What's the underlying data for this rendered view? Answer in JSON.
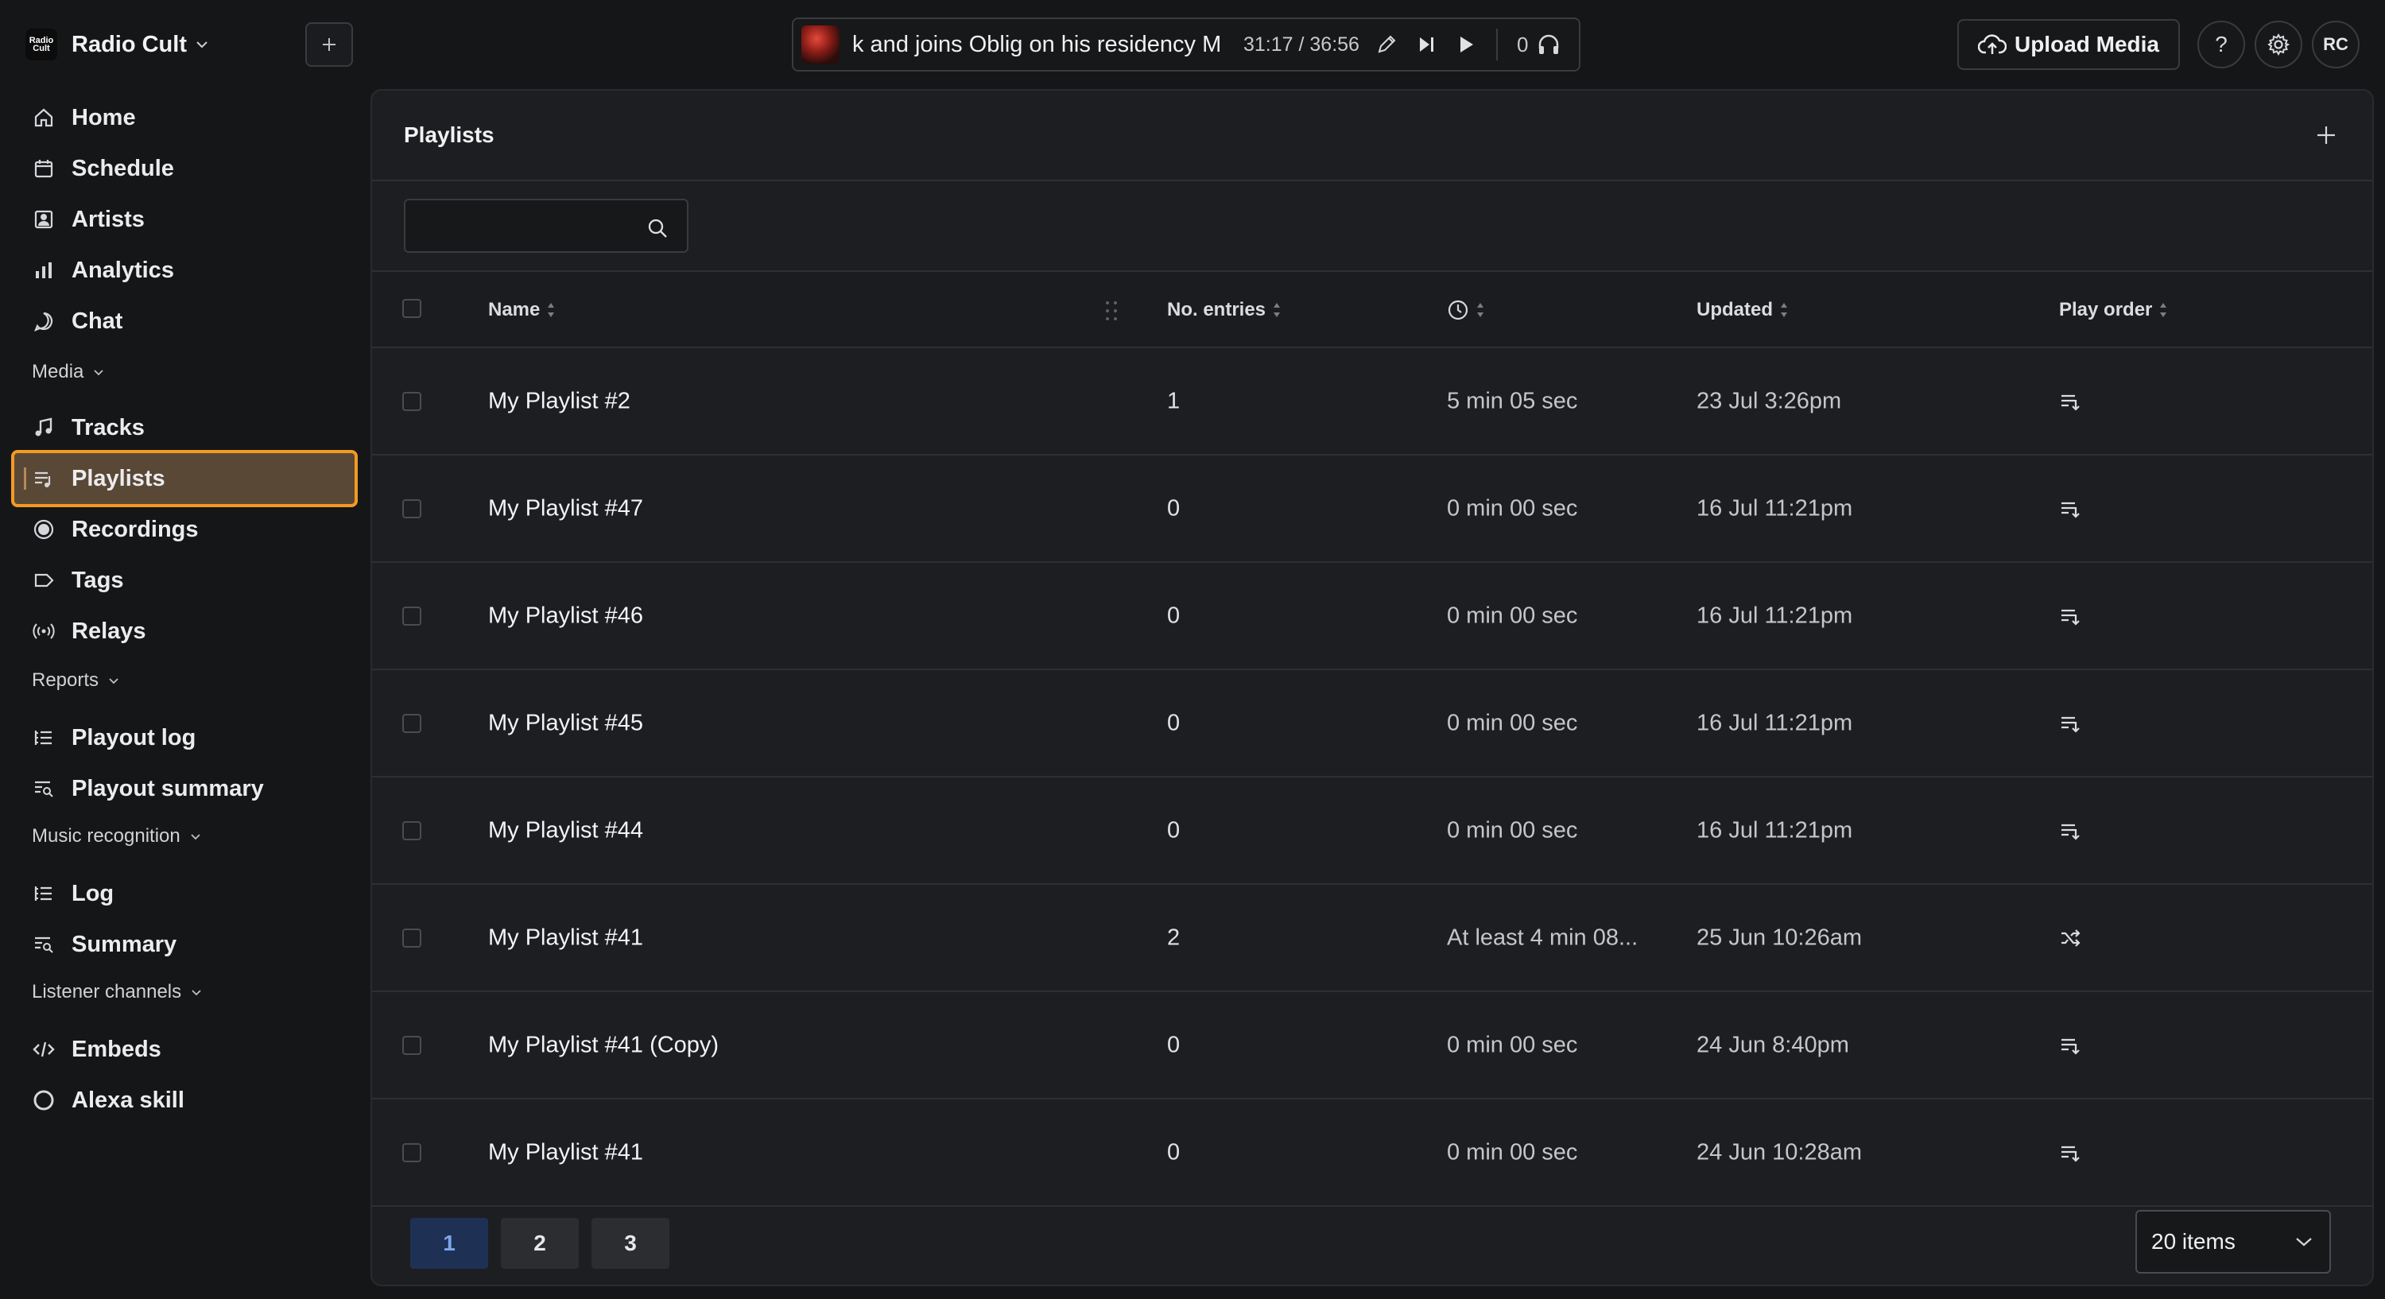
{
  "brand": {
    "name": "Radio Cult",
    "logo_text": "Radio Cult"
  },
  "sidebar": {
    "main_items": [
      {
        "label": "Home",
        "icon": "home-icon"
      },
      {
        "label": "Schedule",
        "icon": "calendar-icon"
      },
      {
        "label": "Artists",
        "icon": "artist-icon"
      },
      {
        "label": "Analytics",
        "icon": "bar-chart-icon"
      },
      {
        "label": "Chat",
        "icon": "chat-icon"
      }
    ],
    "sections": [
      {
        "label": "Media",
        "items": [
          {
            "label": "Tracks",
            "icon": "music-note-icon"
          },
          {
            "label": "Playlists",
            "icon": "playlist-icon",
            "active": true
          },
          {
            "label": "Recordings",
            "icon": "record-icon"
          },
          {
            "label": "Tags",
            "icon": "tag-icon"
          },
          {
            "label": "Relays",
            "icon": "broadcast-icon"
          }
        ]
      },
      {
        "label": "Reports",
        "items": [
          {
            "label": "Playout log",
            "icon": "list-icon"
          },
          {
            "label": "Playout summary",
            "icon": "summary-icon"
          }
        ]
      },
      {
        "label": "Music recognition",
        "items": [
          {
            "label": "Log",
            "icon": "list-icon"
          },
          {
            "label": "Summary",
            "icon": "summary-icon"
          }
        ]
      },
      {
        "label": "Listener channels",
        "items": [
          {
            "label": "Embeds",
            "icon": "code-icon"
          },
          {
            "label": "Alexa skill",
            "icon": "alexa-icon"
          }
        ]
      }
    ]
  },
  "player": {
    "title": "k and joins Oblig on his residency M",
    "time": "31:17 / 36:56",
    "listeners": "0"
  },
  "topbar": {
    "upload_label": "Upload Media",
    "avatar_initials": "RC"
  },
  "page": {
    "title": "Playlists",
    "search": {
      "value": "",
      "placeholder": ""
    },
    "columns": {
      "name": "Name",
      "entries": "No. entries",
      "updated": "Updated",
      "play_order": "Play order"
    },
    "rows": [
      {
        "name": "My Playlist #2",
        "entries": "1",
        "duration": "5 min 05 sec",
        "updated": "23 Jul 3:26pm",
        "order": "sequential"
      },
      {
        "name": "My Playlist #47",
        "entries": "0",
        "duration": "0 min 00 sec",
        "updated": "16 Jul 11:21pm",
        "order": "sequential"
      },
      {
        "name": "My Playlist #46",
        "entries": "0",
        "duration": "0 min 00 sec",
        "updated": "16 Jul 11:21pm",
        "order": "sequential"
      },
      {
        "name": "My Playlist #45",
        "entries": "0",
        "duration": "0 min 00 sec",
        "updated": "16 Jul 11:21pm",
        "order": "sequential"
      },
      {
        "name": "My Playlist #44",
        "entries": "0",
        "duration": "0 min 00 sec",
        "updated": "16 Jul 11:21pm",
        "order": "sequential"
      },
      {
        "name": "My Playlist #41",
        "entries": "2",
        "duration": "At least 4 min 08...",
        "updated": "25 Jun 10:26am",
        "order": "shuffle"
      },
      {
        "name": "My Playlist #41 (Copy)",
        "entries": "0",
        "duration": "0 min 00 sec",
        "updated": "24 Jun 8:40pm",
        "order": "sequential"
      },
      {
        "name": "My Playlist #41",
        "entries": "0",
        "duration": "0 min 00 sec",
        "updated": "24 Jun 10:28am",
        "order": "sequential"
      }
    ],
    "pagination": {
      "pages": [
        "1",
        "2",
        "3"
      ],
      "current": "1"
    },
    "page_size": "20 items"
  },
  "colors": {
    "accent": "#f39a22",
    "active_bg": "#5a4837",
    "page_current": "#1e3154",
    "background": "#151618",
    "panel": "#1d1e21"
  }
}
